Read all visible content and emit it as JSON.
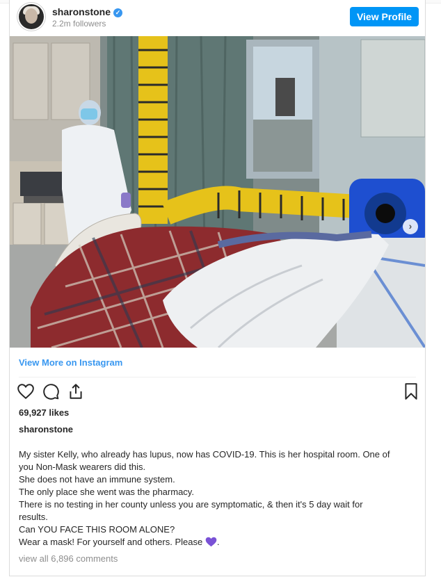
{
  "header": {
    "username": "sharonstone",
    "verified_icon": "verified-badge-icon",
    "followers": "2.2m followers",
    "view_profile_label": "View Profile"
  },
  "photo": {
    "alt_icon": "hospital-room-photo",
    "next_icon": "chevron-right-icon",
    "carousel_count": 3,
    "carousel_active": 1
  },
  "view_more_label": "View More on Instagram",
  "actions": {
    "like_icon": "heart-icon",
    "comment_icon": "comment-icon",
    "share_icon": "share-icon",
    "save_icon": "bookmark-icon"
  },
  "likes": "69,927 likes",
  "caption": {
    "username": "sharonstone",
    "lines": [
      "My sister Kelly, who already has lupus, now has COVID-19. This is her hospital room. One of",
      "you Non-Mask wearers did this.",
      "She does not have an immune system.",
      "The only place she went was the pharmacy.",
      "There is no testing in her county unless you are symptomatic, & then it's 5 day wait for",
      "results.",
      "Can YOU FACE THIS ROOM ALONE?",
      "Wear a mask! For yourself and others. Please"
    ],
    "line_end": ".",
    "emoji_color": "#7a52d6"
  },
  "comments_link": "view all 6,896 comments",
  "colors": {
    "accent": "#0095f6",
    "link": "#3897f0",
    "muted": "#8e8e8e"
  }
}
